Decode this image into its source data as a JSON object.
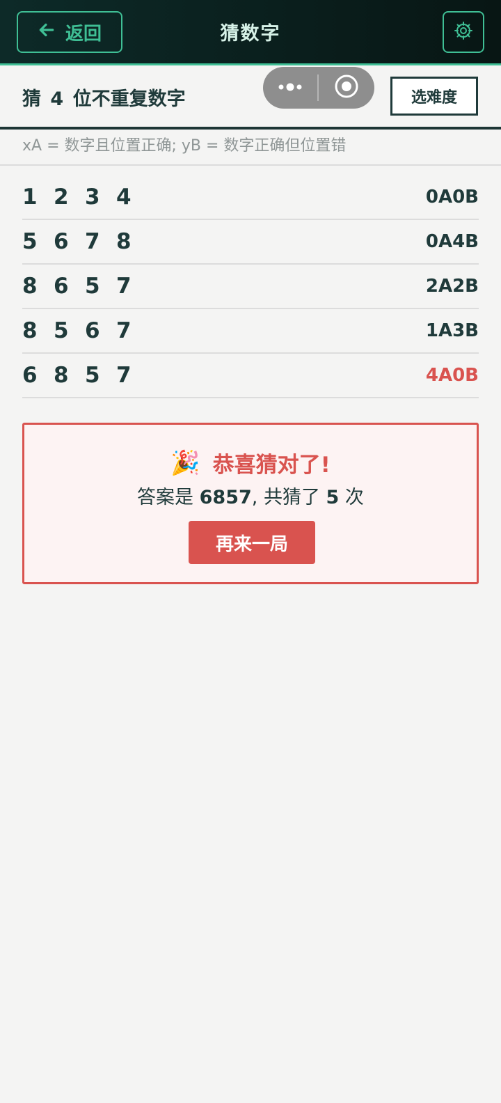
{
  "header": {
    "back_label": "返回",
    "title": "猜数字"
  },
  "subbar": {
    "subtitle": "猜 4 位不重复数字",
    "difficulty_label": "选难度"
  },
  "legend": "xA = 数字且位置正确; yB = 数字正确但位置错",
  "guesses": [
    {
      "digits": [
        "1",
        "2",
        "3",
        "4"
      ],
      "result": "0A0B"
    },
    {
      "digits": [
        "5",
        "6",
        "7",
        "8"
      ],
      "result": "0A4B"
    },
    {
      "digits": [
        "8",
        "6",
        "5",
        "7"
      ],
      "result": "2A2B"
    },
    {
      "digits": [
        "8",
        "5",
        "6",
        "7"
      ],
      "result": "1A3B"
    },
    {
      "digits": [
        "6",
        "8",
        "5",
        "7"
      ],
      "result": "4A0B"
    }
  ],
  "win": {
    "emoji": "🎉",
    "message": "恭喜猜对了!",
    "answer_prefix": "答案是 ",
    "answer": "6857",
    "count_prefix": ", 共猜了 ",
    "count": "5",
    "count_suffix": " 次",
    "again_label": "再来一局"
  },
  "colors": {
    "accent": "#3fbf95",
    "win": "#d9534f",
    "text": "#1f3a3a"
  }
}
